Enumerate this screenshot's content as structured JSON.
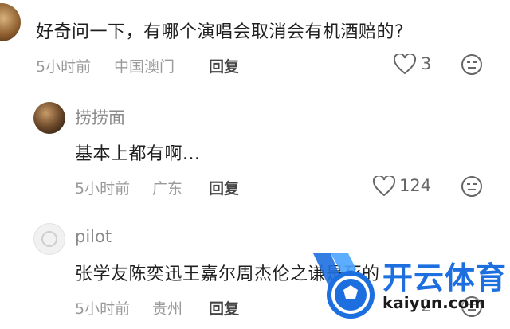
{
  "comments": [
    {
      "text": "好奇问一下，有哪个演唱会取消会有机酒赔的?",
      "time": "5小时前",
      "location": "中国澳门",
      "reply_label": "回复",
      "likes": "3"
    },
    {
      "username": "捞捞面",
      "text": "基本上都有啊...",
      "time": "5小时前",
      "location": "广东",
      "reply_label": "回复",
      "likes": "124"
    },
    {
      "username": "pilot",
      "text": "张学友陈奕迅王嘉尔周杰伦之谦是死的",
      "time": "5小时前",
      "location": "贵州",
      "reply_label": "回复",
      "likes": "2"
    }
  ],
  "watermark": {
    "title": "开云体育",
    "url": "kaiyun.com"
  },
  "colors": {
    "watermark_blue": "#1d6fe0",
    "meta_gray": "#9a9a9a"
  }
}
